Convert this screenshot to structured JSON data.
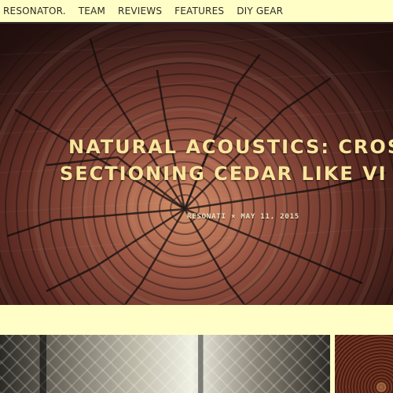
{
  "nav": {
    "items": [
      {
        "label": "RESONATOR."
      },
      {
        "label": "TEAM"
      },
      {
        "label": "REVIEWS"
      },
      {
        "label": "FEATURES"
      },
      {
        "label": "DIY GEAR"
      }
    ]
  },
  "hero": {
    "title_line1": "NATURAL ACOUSTICS: CROSS",
    "title_line2": "SECTIONING CEDAR LIKE VI",
    "meta": "RESONATI  ×  MAY 11, 2015"
  },
  "colors": {
    "page_bg": "#fffec7",
    "nav_text": "#2a2a2a",
    "hero_title": "#f9e59b",
    "hero_meta": "#efe6c4"
  },
  "icons": {
    "none": ""
  }
}
